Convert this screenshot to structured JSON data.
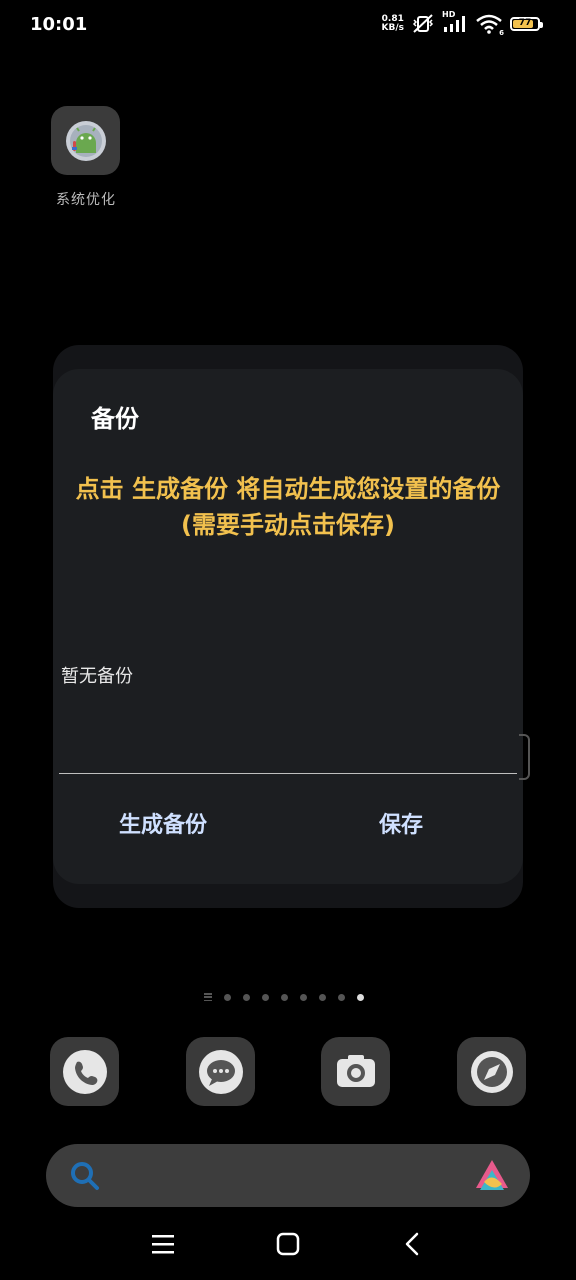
{
  "status_bar": {
    "time": "10:01",
    "speed_value": "0.81",
    "speed_unit": "KB/s",
    "hd_label": "HD",
    "wifi_sub": "6",
    "battery": "77"
  },
  "home": {
    "app_label": "系统优化",
    "page_count": 8,
    "active_page": 8
  },
  "dialog": {
    "title": "备份",
    "message": "点击 生成备份 将自动生成您设置的备份(需要手动点击保存)",
    "empty_text": "暂无备份",
    "generate_label": "生成备份",
    "save_label": "保存"
  },
  "dock": {
    "icons": [
      "phone-icon",
      "message-icon",
      "camera-icon",
      "browser-icon"
    ]
  },
  "colors": {
    "accent_yellow": "#f2c14e",
    "button_text": "#cfe0ff",
    "dialog_bg": "#1c1e21"
  }
}
